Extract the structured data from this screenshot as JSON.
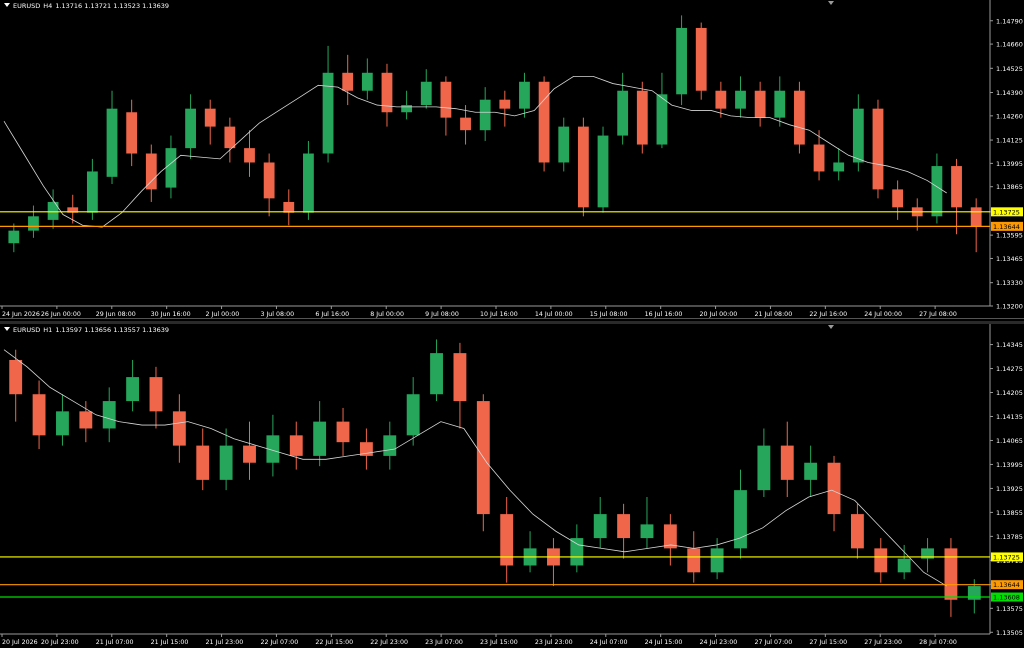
{
  "chart_data": [
    {
      "type": "candlestick",
      "symbol": "EURUSD",
      "timeframe": "H4",
      "ohlc_text": "1.13716 1.13721 1.13523 1.13639",
      "ylim": [
        1.132,
        1.1485
      ],
      "y_ticks": [
        "1.14790",
        "1.14660",
        "1.14525",
        "1.14390",
        "1.14260",
        "1.14125",
        "1.13995",
        "1.13865",
        "1.13725",
        "1.13595",
        "1.13465",
        "1.13330",
        "1.13200"
      ],
      "x_ticks": [
        "24 Jun 2026",
        "26 Jun 00:00",
        "29 Jun 08:00",
        "30 Jun 16:00",
        "2 Jul 00:00",
        "3 Jul 08:00",
        "6 Jul 16:00",
        "8 Jul 00:00",
        "9 Jul 08:00",
        "10 Jul 16:00",
        "14 Jul 00:00",
        "15 Jul 08:00",
        "16 Jul 16:00",
        "20 Jul 00:00",
        "21 Jul 08:00",
        "22 Jul 16:00",
        "24 Jul 00:00",
        "27 Jul 08:00"
      ],
      "moving_average": [
        1.1423,
        1.1405,
        1.1387,
        1.1371,
        1.1365,
        1.1364,
        1.1372,
        1.1384,
        1.1395,
        1.1404,
        1.1403,
        1.1402,
        1.1412,
        1.1422,
        1.1429,
        1.1436,
        1.1443,
        1.1442,
        1.1436,
        1.1432,
        1.1431,
        1.1431,
        1.1431,
        1.143,
        1.1428,
        1.1428,
        1.1426,
        1.1429,
        1.1441,
        1.1448,
        1.1448,
        1.1444,
        1.1442,
        1.144,
        1.1432,
        1.1429,
        1.1429,
        1.1426,
        1.1425,
        1.1425,
        1.1421,
        1.1418,
        1.1411,
        1.1404,
        1.14,
        1.1398,
        1.1395,
        1.139,
        1.1383
      ],
      "horizontal_lines": [
        {
          "price": 1.13725,
          "label": "1.13725",
          "color": "#ffff00"
        },
        {
          "price": 1.13644,
          "label": "1.13644",
          "color": "#ff9900"
        }
      ],
      "candles": [
        [
          1.1355,
          1.1362,
          1.135,
          1.1366
        ],
        [
          1.1362,
          1.137,
          1.1358,
          1.1376
        ],
        [
          1.1368,
          1.1378,
          1.1363,
          1.1385
        ],
        [
          1.1375,
          1.1372,
          1.1366,
          1.1382
        ],
        [
          1.1372,
          1.1395,
          1.1368,
          1.1402
        ],
        [
          1.1392,
          1.143,
          1.1388,
          1.144
        ],
        [
          1.1428,
          1.1405,
          1.1398,
          1.1435
        ],
        [
          1.1405,
          1.1385,
          1.1378,
          1.141
        ],
        [
          1.1386,
          1.1408,
          1.138,
          1.1415
        ],
        [
          1.1408,
          1.143,
          1.1402,
          1.1438
        ],
        [
          1.143,
          1.142,
          1.141,
          1.1435
        ],
        [
          1.142,
          1.1408,
          1.14,
          1.1425
        ],
        [
          1.1408,
          1.14,
          1.1392,
          1.1418
        ],
        [
          1.14,
          1.138,
          1.137,
          1.1405
        ],
        [
          1.1378,
          1.1372,
          1.1365,
          1.1385
        ],
        [
          1.1372,
          1.1405,
          1.1368,
          1.1412
        ],
        [
          1.1405,
          1.145,
          1.14,
          1.1465
        ],
        [
          1.145,
          1.144,
          1.1432,
          1.146
        ],
        [
          1.144,
          1.145,
          1.1435,
          1.1458
        ],
        [
          1.145,
          1.1428,
          1.142,
          1.1455
        ],
        [
          1.1428,
          1.1432,
          1.1424,
          1.144
        ],
        [
          1.1432,
          1.1445,
          1.143,
          1.1452
        ],
        [
          1.1445,
          1.1425,
          1.1415,
          1.1448
        ],
        [
          1.1425,
          1.1418,
          1.141,
          1.1432
        ],
        [
          1.1418,
          1.1435,
          1.1412,
          1.1442
        ],
        [
          1.1435,
          1.143,
          1.142,
          1.144
        ],
        [
          1.143,
          1.1445,
          1.1425,
          1.145
        ],
        [
          1.1445,
          1.14,
          1.1395,
          1.1448
        ],
        [
          1.14,
          1.142,
          1.1395,
          1.1425
        ],
        [
          1.142,
          1.1375,
          1.137,
          1.1425
        ],
        [
          1.1375,
          1.1415,
          1.1372,
          1.142
        ],
        [
          1.1415,
          1.144,
          1.141,
          1.145
        ],
        [
          1.144,
          1.141,
          1.1405,
          1.1445
        ],
        [
          1.141,
          1.1438,
          1.1408,
          1.145
        ],
        [
          1.1438,
          1.1475,
          1.1432,
          1.1482
        ],
        [
          1.1475,
          1.144,
          1.1435,
          1.1478
        ],
        [
          1.144,
          1.143,
          1.1425,
          1.1445
        ],
        [
          1.143,
          1.144,
          1.1425,
          1.1448
        ],
        [
          1.144,
          1.1425,
          1.142,
          1.1445
        ],
        [
          1.1425,
          1.144,
          1.142,
          1.1448
        ],
        [
          1.144,
          1.141,
          1.1405,
          1.1445
        ],
        [
          1.141,
          1.1395,
          1.139,
          1.1418
        ],
        [
          1.1395,
          1.14,
          1.139,
          1.1408
        ],
        [
          1.14,
          1.143,
          1.1395,
          1.1438
        ],
        [
          1.143,
          1.1385,
          1.138,
          1.1435
        ],
        [
          1.1385,
          1.1375,
          1.1368,
          1.139
        ],
        [
          1.1375,
          1.137,
          1.1362,
          1.138
        ],
        [
          1.137,
          1.1398,
          1.1366,
          1.1405
        ],
        [
          1.1398,
          1.1375,
          1.136,
          1.1402
        ],
        [
          1.1375,
          1.1364,
          1.135,
          1.138
        ]
      ]
    },
    {
      "type": "candlestick",
      "symbol": "EURUSD",
      "timeframe": "H1",
      "ohlc_text": "1.13597 1.13656 1.13557 1.13639",
      "ylim": [
        1.135,
        1.1437
      ],
      "y_ticks": [
        "1.14345",
        "1.14275",
        "1.14205",
        "1.14135",
        "1.14065",
        "1.13995",
        "1.13925",
        "1.13855",
        "1.13785",
        "1.13715",
        "1.13645",
        "1.13575",
        "1.13505"
      ],
      "x_ticks": [
        "20 Jul 2026",
        "20 Jul 23:00",
        "21 Jul 07:00",
        "21 Jul 15:00",
        "21 Jul 23:00",
        "22 Jul 07:00",
        "22 Jul 15:00",
        "22 Jul 23:00",
        "23 Jul 07:00",
        "23 Jul 15:00",
        "23 Jul 23:00",
        "24 Jul 07:00",
        "24 Jul 15:00",
        "24 Jul 23:00",
        "27 Jul 07:00",
        "27 Jul 15:00",
        "27 Jul 23:00",
        "28 Jul 07:00"
      ],
      "moving_average": [
        1.1433,
        1.1428,
        1.1422,
        1.1418,
        1.1414,
        1.1412,
        1.1411,
        1.1411,
        1.1412,
        1.141,
        1.1407,
        1.1405,
        1.1403,
        1.1401,
        1.1401,
        1.1402,
        1.1403,
        1.1404,
        1.1408,
        1.1412,
        1.141,
        1.14,
        1.1392,
        1.1385,
        1.138,
        1.1376,
        1.1375,
        1.1374,
        1.1375,
        1.1376,
        1.1375,
        1.1376,
        1.1378,
        1.1381,
        1.1386,
        1.139,
        1.1392,
        1.1389,
        1.1382,
        1.1375,
        1.1368,
        1.1364
      ],
      "horizontal_lines": [
        {
          "price": 1.13725,
          "label": "1.13725",
          "color": "#ffff00"
        },
        {
          "price": 1.13644,
          "label": "1.13644",
          "color": "#ff9900"
        },
        {
          "price": 1.13608,
          "label": "1.13608",
          "color": "#00dd00"
        }
      ],
      "candles": [
        [
          1.143,
          1.142,
          1.1412,
          1.1433
        ],
        [
          1.142,
          1.1408,
          1.1404,
          1.1424
        ],
        [
          1.1408,
          1.1415,
          1.1405,
          1.142
        ],
        [
          1.1415,
          1.141,
          1.1406,
          1.1418
        ],
        [
          1.141,
          1.1418,
          1.1406,
          1.1422
        ],
        [
          1.1418,
          1.1425,
          1.1415,
          1.143
        ],
        [
          1.1425,
          1.1415,
          1.141,
          1.1428
        ],
        [
          1.1415,
          1.1405,
          1.14,
          1.142
        ],
        [
          1.1405,
          1.1395,
          1.1392,
          1.141
        ],
        [
          1.1395,
          1.1405,
          1.1392,
          1.141
        ],
        [
          1.1405,
          1.14,
          1.1395,
          1.1412
        ],
        [
          1.14,
          1.1408,
          1.1396,
          1.1414
        ],
        [
          1.1408,
          1.1402,
          1.1398,
          1.1412
        ],
        [
          1.1402,
          1.1412,
          1.1399,
          1.1418
        ],
        [
          1.1412,
          1.1406,
          1.1402,
          1.1416
        ],
        [
          1.1406,
          1.1402,
          1.1398,
          1.141
        ],
        [
          1.1402,
          1.1408,
          1.1398,
          1.1412
        ],
        [
          1.1408,
          1.142,
          1.1405,
          1.1425
        ],
        [
          1.142,
          1.1432,
          1.1418,
          1.1436
        ],
        [
          1.1432,
          1.1418,
          1.141,
          1.1435
        ],
        [
          1.1418,
          1.1385,
          1.138,
          1.142
        ],
        [
          1.1385,
          1.137,
          1.1365,
          1.139
        ],
        [
          1.137,
          1.1375,
          1.1368,
          1.138
        ],
        [
          1.1375,
          1.137,
          1.1364,
          1.1378
        ],
        [
          1.137,
          1.1378,
          1.1368,
          1.1382
        ],
        [
          1.1378,
          1.1385,
          1.1375,
          1.139
        ],
        [
          1.1385,
          1.1378,
          1.1372,
          1.1388
        ],
        [
          1.1378,
          1.1382,
          1.1375,
          1.139
        ],
        [
          1.1382,
          1.1375,
          1.137,
          1.1385
        ],
        [
          1.1375,
          1.1368,
          1.1365,
          1.138
        ],
        [
          1.1368,
          1.1375,
          1.1366,
          1.1378
        ],
        [
          1.1375,
          1.1392,
          1.1372,
          1.1398
        ],
        [
          1.1392,
          1.1405,
          1.139,
          1.141
        ],
        [
          1.1405,
          1.1395,
          1.139,
          1.1412
        ],
        [
          1.1395,
          1.14,
          1.139,
          1.1405
        ],
        [
          1.14,
          1.1385,
          1.138,
          1.1402
        ],
        [
          1.1385,
          1.1375,
          1.1372,
          1.1388
        ],
        [
          1.1375,
          1.1368,
          1.1365,
          1.1378
        ],
        [
          1.1368,
          1.1372,
          1.1366,
          1.1376
        ],
        [
          1.1372,
          1.1375,
          1.1368,
          1.1378
        ],
        [
          1.1375,
          1.136,
          1.1355,
          1.1378
        ],
        [
          1.136,
          1.1364,
          1.1356,
          1.1366
        ]
      ]
    }
  ]
}
